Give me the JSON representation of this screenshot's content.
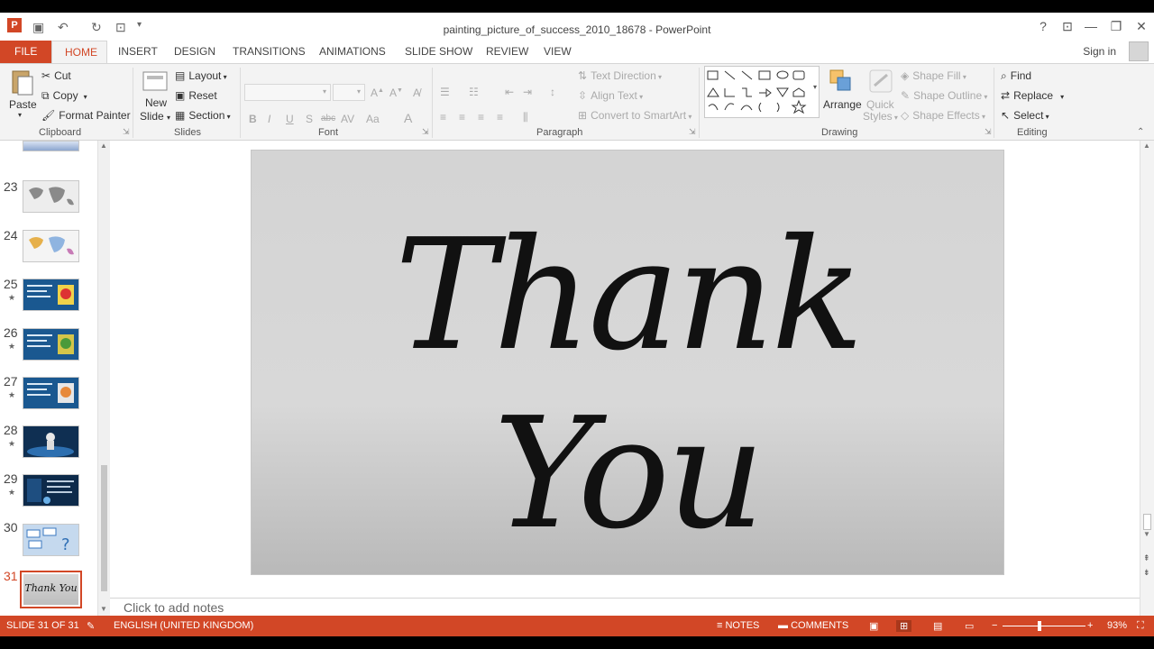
{
  "window": {
    "title": "painting_picture_of_success_2010_18678 - PowerPoint",
    "help": "?",
    "ribbon_display": "⊡",
    "minimize": "—",
    "restore": "❐",
    "close": "✕"
  },
  "quick_access": {
    "app_icon": "P",
    "save": "💾",
    "undo": "↶",
    "redo": "↻",
    "customize": "▾"
  },
  "tabs": {
    "file": "FILE",
    "home": "HOME",
    "items": [
      "INSERT",
      "DESIGN",
      "TRANSITIONS",
      "ANIMATIONS",
      "SLIDE SHOW",
      "REVIEW",
      "VIEW"
    ],
    "sign_in": "Sign in"
  },
  "ribbon": {
    "clipboard": {
      "label": "Clipboard",
      "paste": "Paste",
      "cut": "Cut",
      "copy": "Copy",
      "format_painter": "Format Painter"
    },
    "slides": {
      "label": "Slides",
      "new_slide_1": "New",
      "new_slide_2": "Slide",
      "layout": "Layout",
      "reset": "Reset",
      "section": "Section"
    },
    "font": {
      "label": "Font",
      "bold": "B",
      "italic": "I",
      "underline": "U",
      "shadow": "S",
      "strike": "abc"
    },
    "paragraph": {
      "label": "Paragraph",
      "text_direction": "Text Direction",
      "align_text": "Align Text",
      "convert_smartart": "Convert to SmartArt"
    },
    "drawing": {
      "label": "Drawing",
      "arrange": "Arrange",
      "quick_styles_1": "Quick",
      "quick_styles_2": "Styles",
      "shape_fill": "Shape Fill",
      "shape_outline": "Shape Outline",
      "shape_effects": "Shape Effects"
    },
    "editing": {
      "label": "Editing",
      "find": "Find",
      "replace": "Replace",
      "select": "Select"
    }
  },
  "thumbnails": [
    {
      "num": "23",
      "star": ""
    },
    {
      "num": "24",
      "star": ""
    },
    {
      "num": "25",
      "star": "★"
    },
    {
      "num": "26",
      "star": "★"
    },
    {
      "num": "27",
      "star": "★"
    },
    {
      "num": "28",
      "star": "★"
    },
    {
      "num": "29",
      "star": "★"
    },
    {
      "num": "30",
      "star": ""
    },
    {
      "num": "31",
      "star": "",
      "thumb_text": "Thank You"
    }
  ],
  "slide": {
    "text": "Thank You"
  },
  "notes": {
    "placeholder": "Click to add notes"
  },
  "status": {
    "slide_count": "SLIDE 31 OF 31",
    "language": "ENGLISH (UNITED KINGDOM)",
    "notes": "NOTES",
    "comments": "COMMENTS",
    "zoom": "93%"
  },
  "colors": {
    "accent": "#d24726",
    "ribbon_bg": "#f3f3f3",
    "slide_bg": "#d6d6d6"
  }
}
